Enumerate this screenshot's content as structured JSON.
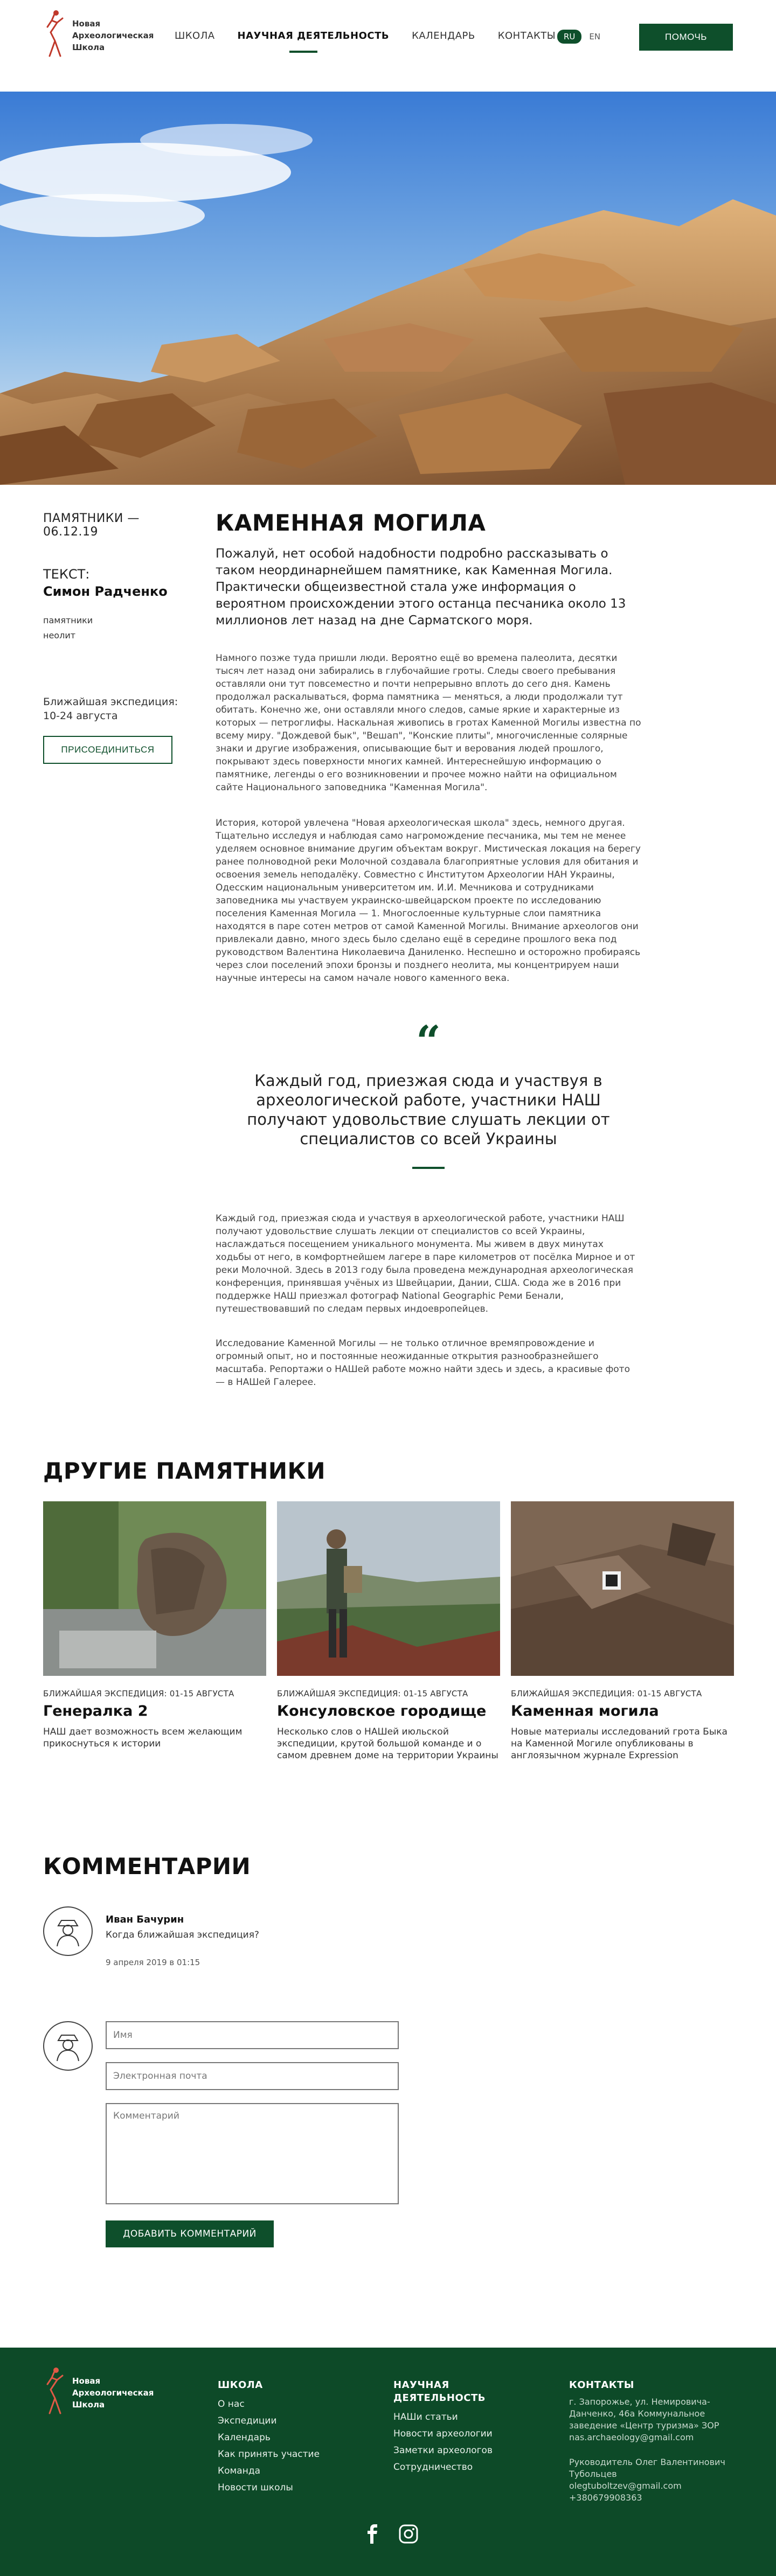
{
  "header": {
    "logo_text": "Новая Археологическая Школа",
    "nav": [
      "ШКОЛА",
      "НАУЧНАЯ ДЕЯТЕЛЬНОСТЬ",
      "КАЛЕНДАРЬ",
      "КОНТАКТЫ"
    ],
    "lang_ru": "RU",
    "lang_en": "EN",
    "help": "ПОМОЧЬ"
  },
  "colors": {
    "accent": "#0e4f2b",
    "footer_bg": "#0d4a28"
  },
  "article": {
    "date": "ПАМЯТНИКИ — 06.12.19",
    "author_label": "ТЕКСТ:",
    "author": "Симон Радченко",
    "tags": [
      "памятники",
      "неолит"
    ],
    "expedition": "Ближайшая экспедиция: 10-24 августа",
    "join": "ПРИСОЕДИНИТЬСЯ",
    "title": "КАМЕННАЯ МОГИЛА",
    "lead": "Пожалуй, нет особой надобности подробно рассказывать о таком неординарнейшем памятнике, как Каменная Могила. Практически общеизвестной стала уже информация о вероятном происхождении этого останца песчаника около 13 миллионов лет назад на дне Сарматского моря.",
    "p1": "Намного позже туда пришли люди. Вероятно ещё во времена палеолита, десятки тысяч лет назад они забирались в глубочайшие гроты. Следы своего пребывания оставляли они тут повсеместно и почти непрерывно вплоть до сего дня. Камень продолжал раскалываться, форма памятника — меняться, а люди продолжали тут обитать. Конечно же, они оставляли много следов, самые яркие и характерные из которых — петроглифы. Наскальная живопись в гротах Каменной Могилы известна по всему миру. \"Дождевой бык\", \"Вешап\", \"Конские плиты\", многочисленные солярные знаки и другие изображения, описывающие быт и верования людей прошлого, покрывают здесь поверхности многих камней. Интереснейшую информацию о памятнике, легенды о его возникновении и прочее можно найти на официальном сайте Национального заповедника \"Каменная Могила\".",
    "p2": "История, которой увлечена \"Новая археологическая школа\" здесь, немного другая. Тщательно исследуя и наблюдая само нагромождение песчаника, мы тем не менее уделяем основное внимание другим объектам вокруг. Мистическая локация на берегу ранее полноводной реки Молочной создавала благоприятные условия для обитания и освоения земель неподалёку. Совместно с Институтом Археологии НАН Украины, Одесским национальным университетом им. И.И. Мечникова и сотрудниками заповедника мы участвуем украинско-швейцарском проекте по исследованию поселения Каменная Могила — 1. Многослоенные культурные слои памятника находятся в паре сотен метров от самой Каменной Могилы. Внимание археологов они привлекали давно, много здесь было сделано ещё в середине прошлого века под руководством Валентина Николаевича Даниленко. Неспешно и осторожно пробираясь через слои поселений эпохи бронзы и позднего неолита, мы концентрируем наши научные интересы на самом начале нового каменного века.",
    "quote": "Каждый год, приезжая сюда и участвуя в археологической работе, участники НАШ получают удовольствие слушать лекции от специалистов со всей Украины",
    "p3": "Каждый год, приезжая сюда и участвуя в археологической работе, участники НАШ получают удовольствие слушать лекции от специалистов со всей Украины, наслаждаться посещением уникального монумента. Мы живем в двух минутах ходьбы от него, в комфортнейшем лагере в паре километров от посёлка Мирное и от реки Молочной. Здесь в 2013 году была проведена международная археологическая конференция, принявшая учёных из Швейцарии, Дании, США. Сюда же в 2016 при поддержке НАШ приезжал фотограф National Geographic Реми Бенали, путешествовавший по следам первых индоевропейцев.",
    "p4": "Исследование Каменной Могилы — не только отличное времяпровождение и огромный опыт, но и постоянные неожиданные открытия разнообразнейшего масштаба. Репортажи о НАШей работе можно найти здесь и здесь, а красивые фото — в НАШей Галерее."
  },
  "others": {
    "title": "ДРУГИЕ ПАМЯТНИКИ",
    "cards": [
      {
        "meta": "БЛИЖАЙШАЯ ЭКСПЕДИЦИЯ: 01-15 АВГУСТА",
        "title": "Генералка 2",
        "desc": "НАШ дает возможность всем желающим прикоснуться к истории"
      },
      {
        "meta": "БЛИЖАЙШАЯ ЭКСПЕДИЦИЯ: 01-15 АВГУСТА",
        "title": "Консуловское городище",
        "desc": "Несколько слов о НАШей июльской экспедиции, крутой большой команде и о самом древнем доме на территории Украины"
      },
      {
        "meta": "БЛИЖАЙШАЯ ЭКСПЕДИЦИЯ: 01-15 АВГУСТА",
        "title": "Каменная могила",
        "desc": "Новые материалы исследований грота Быка на Каменной Могиле опубликованы в англоязычном журнале Expression"
      }
    ]
  },
  "comments": {
    "title": "КОММЕНТАРИИ",
    "items": [
      {
        "name": "Иван Бачурин",
        "text": "Когда ближайшая экспедиция?",
        "date": "9 апреля 2019 в 01:15"
      }
    ],
    "form": {
      "name_placeholder": "Имя",
      "email_placeholder": "Электронная почта",
      "comment_placeholder": "Комментарий",
      "submit": "ДОБАВИТЬ КОММЕНТАРИЙ"
    }
  },
  "footer": {
    "logo_text": "Новая Археологическая Школа",
    "school_title": "ШКОЛА",
    "school_links": [
      "О нас",
      "Экспедиции",
      "Календарь",
      "Как принять участие",
      "Команда",
      "Новости школы"
    ],
    "science_title": "НАУЧНАЯ ДЕЯТЕЛЬНОСТЬ",
    "science_links": [
      "НАШи статьи",
      "Новости археологии",
      "Заметки археологов",
      "Сотрудничество"
    ],
    "contacts_title": "КОНТАКТЫ",
    "address": "г. Запорожье, ул. Немировича-Данченко, 46а Коммунальное заведение «Центр туризма» ЗОР nas.archaeology@gmail.com",
    "person": "Руководитель Олег Валентинович Тубольцев olegtuboltzev@gmail.com +380679908363",
    "social": [
      "facebook-icon",
      "instagram-icon"
    ]
  }
}
